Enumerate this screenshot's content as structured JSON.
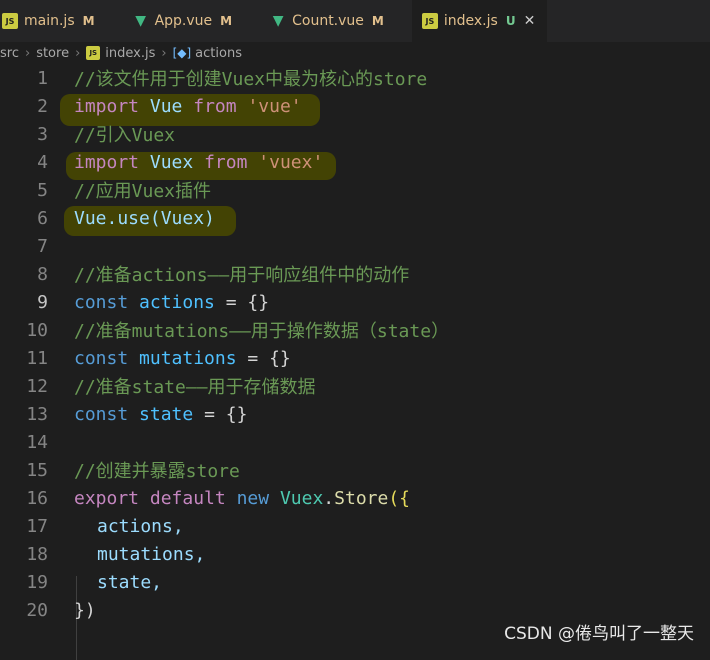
{
  "tabs": [
    {
      "label": "main.js",
      "badge": "M",
      "type": "js"
    },
    {
      "label": "App.vue",
      "badge": "M",
      "type": "vue"
    },
    {
      "label": "Count.vue",
      "badge": "M",
      "type": "vue"
    },
    {
      "label": "index.js",
      "badge": "U",
      "type": "js",
      "active": true
    }
  ],
  "breadcrumb": {
    "p1": "src",
    "p2": "store",
    "p3": "index.js",
    "p4": "actions"
  },
  "line_numbers": [
    "1",
    "2",
    "3",
    "4",
    "5",
    "6",
    "7",
    "8",
    "9",
    "10",
    "11",
    "12",
    "13",
    "14",
    "15",
    "16",
    "17",
    "18",
    "19",
    "20"
  ],
  "code": {
    "l1": "//该文件用于创建Vuex中最为核心的store",
    "l2_kw": "import",
    "l2_a": "Vue",
    "l2_from": "from",
    "l2_str": "'vue'",
    "l3": "//引入Vuex",
    "l4_kw": "import",
    "l4_a": "Vuex",
    "l4_from": "from",
    "l4_str": "'vuex'",
    "l5": "//应用Vuex插件",
    "l6": "Vue.use(Vuex)",
    "l8": "//准备actions——用于响应组件中的动作",
    "l9_kw": "const",
    "l9_var": "actions",
    "l9_rest": "= {}",
    "l10": "//准备mutations——用于操作数据（state）",
    "l11_kw": "const",
    "l11_var": "mutations",
    "l11_rest": "= {}",
    "l12": "//准备state——用于存储数据",
    "l13_kw": "const",
    "l13_var": "state",
    "l13_rest": "= {}",
    "l15": "//创建并暴露store",
    "l16_export": "export",
    "l16_default": "default",
    "l16_new": "new",
    "l16_vuex": "Vuex",
    "l16_store": "Store",
    "l16_rest": "({",
    "l17": "actions,",
    "l18": "mutations,",
    "l19": "state,",
    "l20": "})"
  },
  "watermark": "CSDN @倦鸟叫了一整天"
}
